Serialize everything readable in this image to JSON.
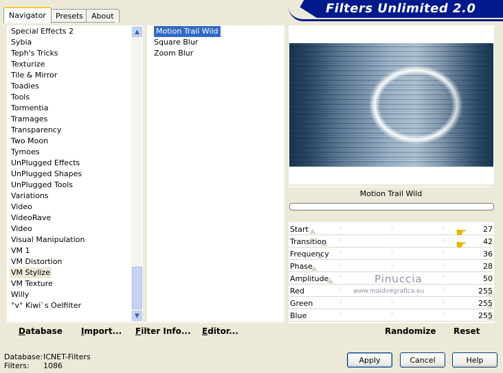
{
  "tabs": [
    "Navigator",
    "Presets",
    "About"
  ],
  "banner_title": "Filters Unlimited 2.0",
  "categories": [
    "Special Effects 2",
    "Sybia",
    "Teph's Tricks",
    "Texturize",
    "Tile & Mirror",
    "Toadies",
    "Tools",
    "Tormentia",
    "Tramages",
    "Transparency",
    "Two Moon",
    "Tymoes",
    "UnPlugged Effects",
    "UnPlugged Shapes",
    "UnPlugged Tools",
    "Variations",
    "Video",
    "VideoRave",
    "Video",
    "Visual Manipulation",
    "VM 1",
    "VM Distortion",
    "VM Stylize",
    "VM Texture",
    "Willy",
    "°v° Kiwi`s Oelfilter"
  ],
  "selected_category": "VM Stylize",
  "filters": [
    "Motion Trail Wild",
    "Square Blur",
    "Zoom Blur"
  ],
  "selected_filter": "Motion Trail Wild",
  "preview_filter_title": "Motion Trail Wild",
  "params": [
    {
      "label": "Start",
      "value": "27"
    },
    {
      "label": "Transition",
      "value": "42"
    },
    {
      "label": "Frequency",
      "value": "36"
    },
    {
      "label": "Phase",
      "value": "28"
    },
    {
      "label": "Amplitude",
      "value": "50"
    },
    {
      "label": "Red",
      "value": "255"
    },
    {
      "label": "Green",
      "value": "255"
    },
    {
      "label": "Blue",
      "value": "255"
    }
  ],
  "watermark": {
    "name": "Pinuccia",
    "url": "www.maidiregrafica.eu"
  },
  "bottom_left_links": {
    "database": "Database",
    "import": "Import...",
    "filter_info": "Filter Info...",
    "editor": "Editor..."
  },
  "bottom_right_links": {
    "randomize": "Randomize",
    "reset": "Reset"
  },
  "status": {
    "database_label": "Database:",
    "database_value": "ICNET-Filters",
    "filters_label": "Filters:",
    "filters_value": "1086"
  },
  "buttons": {
    "apply": "Apply",
    "cancel": "Cancel",
    "help": "Help"
  }
}
